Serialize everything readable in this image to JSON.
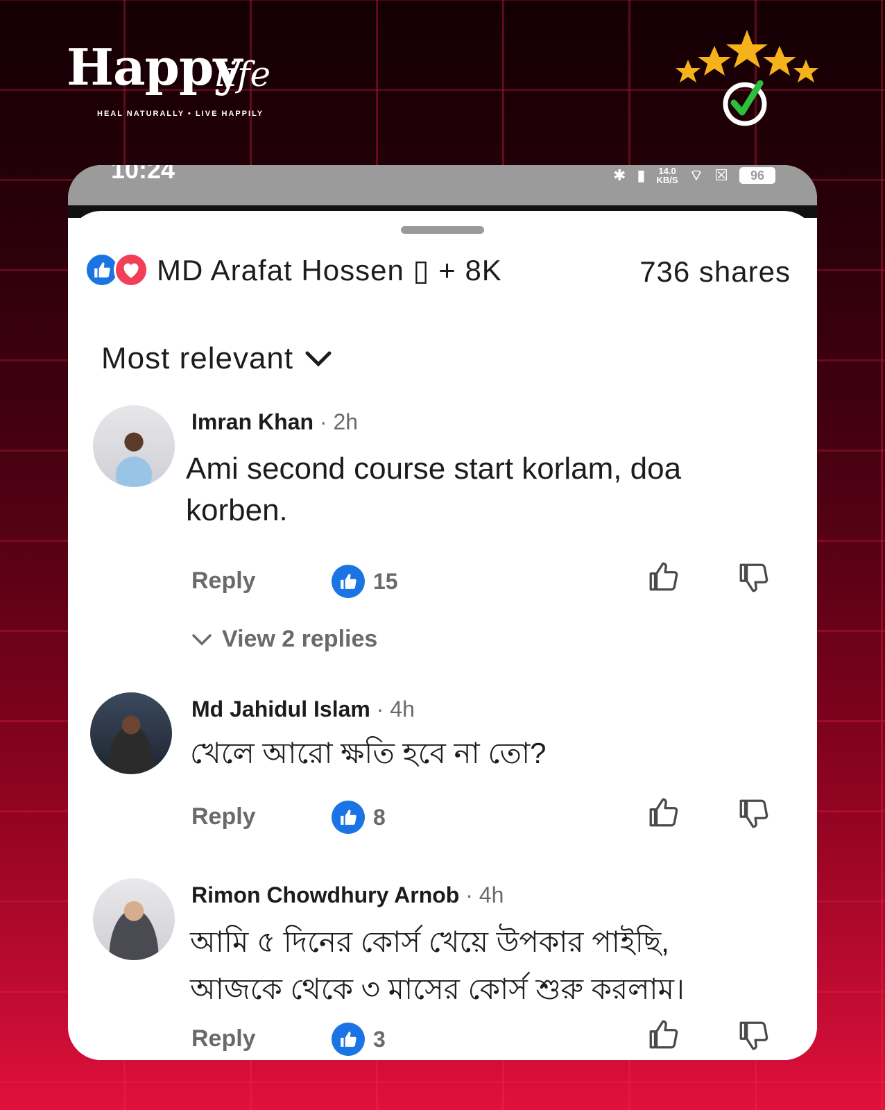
{
  "brand": {
    "logo_main": "Happy",
    "logo_script": "life",
    "tagline": "HEAL NATURALLY  •  LIVE HAPPILY"
  },
  "status_bar": {
    "time": "10:24",
    "speed": "14.0\nKB/S",
    "battery": "96"
  },
  "reactions": {
    "summary": "MD Arafat Hossen ▯ + 8K",
    "shares": "736 shares"
  },
  "sort": {
    "label": "Most relevant"
  },
  "comments": [
    {
      "name": "Imran Khan",
      "time": " · 2h",
      "text": "Ami second course start korlam, doa korben.",
      "reply_label": "Reply",
      "likes": "15",
      "view_replies": "View 2 replies"
    },
    {
      "name": "Md Jahidul Islam",
      "time": " · 4h",
      "text": "খেলে আরো ক্ষতি হবে না তো?",
      "reply_label": "Reply",
      "likes": "8"
    },
    {
      "name": "Rimon Chowdhury Arnob",
      "time": " · 4h",
      "text": "আমি ৫ দিনের কোর্স  খেয়ে উপকার পাইছি, আজকে থেকে ৩ মাসের কোর্স শুরু করলাম।",
      "reply_label": "Reply",
      "likes": "3"
    }
  ],
  "colors": {
    "facebook_blue": "#1b74e4",
    "love_red": "#f33e58",
    "star_gold": "#f5b21b",
    "check_green": "#2bbf3c"
  },
  "icons": [
    "like-icon",
    "love-icon",
    "chevron-down-icon",
    "thumb-up-icon",
    "thumb-down-icon",
    "star-icon",
    "check-icon"
  ]
}
